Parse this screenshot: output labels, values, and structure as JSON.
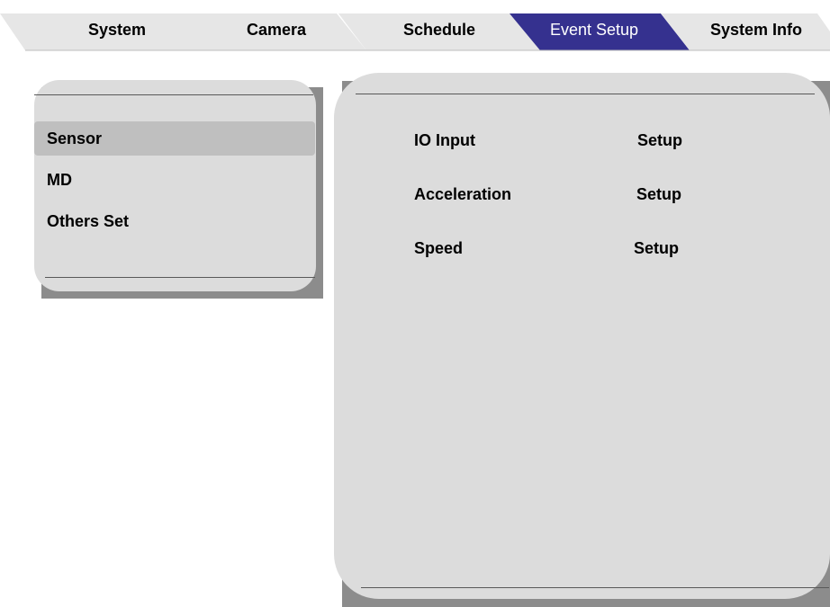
{
  "tabs": [
    {
      "label": "System",
      "active": false
    },
    {
      "label": "Camera",
      "active": false
    },
    {
      "label": "Schedule",
      "active": false
    },
    {
      "label": "Event Setup",
      "active": true
    },
    {
      "label": "System Info",
      "active": false
    }
  ],
  "sidebar": {
    "items": [
      {
        "label": "Sensor",
        "selected": true
      },
      {
        "label": "MD",
        "selected": false
      },
      {
        "label": "Others Set",
        "selected": false
      }
    ]
  },
  "main": {
    "rows": [
      {
        "name": "IO Input",
        "action": "Setup"
      },
      {
        "name": "Acceleration",
        "action": "Setup"
      },
      {
        "name": "Speed",
        "action": "Setup"
      }
    ]
  },
  "colors": {
    "active_tab": "#35318f",
    "panel_bg": "#dcdcdc",
    "panel_shadow": "#8c8c8c",
    "selected_item": "#bfbfbf",
    "tab_bg": "#e6e6e6"
  }
}
